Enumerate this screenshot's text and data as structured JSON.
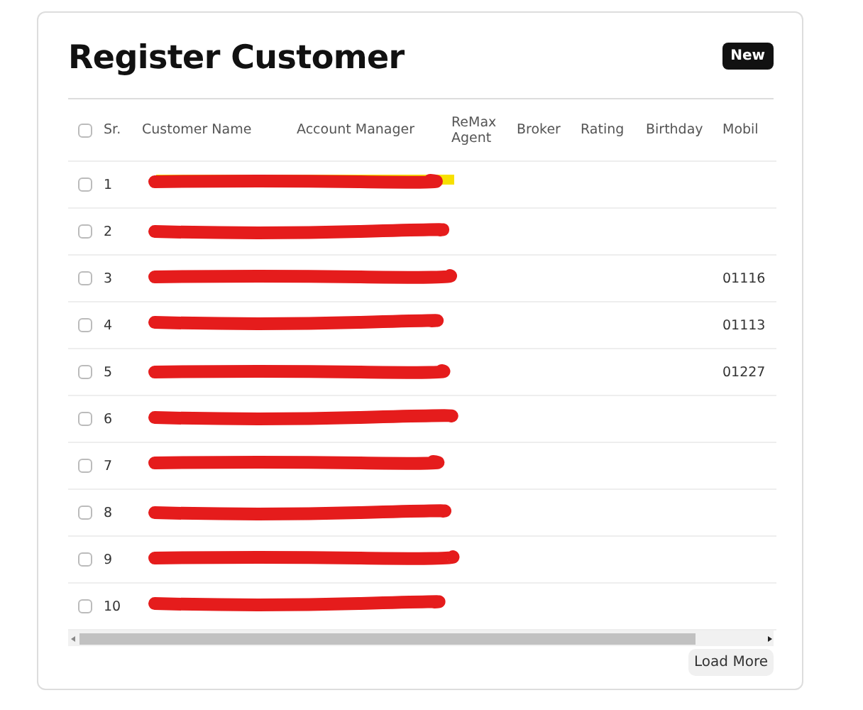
{
  "title": "Register Customer",
  "new_button": "New",
  "table": {
    "columns": [
      "Sr.",
      "Customer Name",
      "Account Manager",
      "ReMax Agent",
      "Broker",
      "Rating",
      "Birthday",
      "Mobil"
    ],
    "header_checked": false,
    "rows": [
      {
        "checked": false,
        "sr": "1",
        "mobile": "",
        "redacted": true,
        "highlighted": true
      },
      {
        "checked": false,
        "sr": "2",
        "mobile": "",
        "redacted": true,
        "highlighted": false
      },
      {
        "checked": false,
        "sr": "3",
        "mobile": "01116",
        "redacted": true,
        "highlighted": false
      },
      {
        "checked": false,
        "sr": "4",
        "mobile": "01113",
        "redacted": true,
        "highlighted": false
      },
      {
        "checked": false,
        "sr": "5",
        "mobile": "01227",
        "redacted": true,
        "highlighted": false
      },
      {
        "checked": false,
        "sr": "6",
        "mobile": "",
        "redacted": true,
        "highlighted": false
      },
      {
        "checked": false,
        "sr": "7",
        "mobile": "",
        "redacted": true,
        "highlighted": false
      },
      {
        "checked": false,
        "sr": "8",
        "mobile": "",
        "redacted": true,
        "highlighted": false
      },
      {
        "checked": false,
        "sr": "9",
        "mobile": "",
        "redacted": true,
        "highlighted": false
      },
      {
        "checked": false,
        "sr": "10",
        "mobile": "",
        "redacted": true,
        "highlighted": false
      }
    ]
  },
  "load_more": "Load More"
}
